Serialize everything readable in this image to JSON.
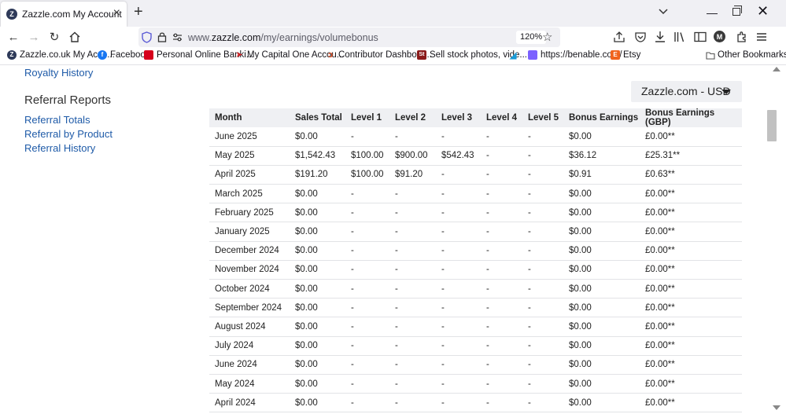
{
  "browser": {
    "tab_title": "Zazzle.com My Account",
    "url_prefix": "www.",
    "url_host": "zazzle.com",
    "url_path": "/my/earnings/volumebonus",
    "zoom": "120%"
  },
  "bookmarks": [
    {
      "label": "Zazzle.co.uk My Acco...",
      "icon": "zazzle-icon",
      "color": "#2e3a59"
    },
    {
      "label": "Facebook",
      "icon": "facebook-icon",
      "color": "#1877f2"
    },
    {
      "label": "Personal Online Banki...",
      "icon": "bank-icon",
      "color": "#d6001c"
    },
    {
      "label": "My Capital One Accou...",
      "icon": "capital-one-icon",
      "color": "#cc2427"
    },
    {
      "label": "Contributor Dashboar...",
      "icon": "contributor-icon",
      "color": "#e4572e"
    },
    {
      "label": "Sell stock photos, vide...",
      "icon": "stock-icon",
      "color": "#8b1a1a"
    },
    {
      "label": "",
      "icon": "feather-icon",
      "color": "#1a9bd7"
    },
    {
      "label": "https://benable.com/",
      "icon": "benable-icon",
      "color": "#7b61ff"
    },
    {
      "label": "Etsy",
      "icon": "etsy-icon",
      "color": "#f1641e"
    },
    {
      "label": "Other Bookmarks",
      "icon": "folder-icon",
      "color": "#555555"
    }
  ],
  "sidebar": {
    "royalty_history": "Royalty History",
    "referral_heading": "Referral Reports",
    "referral_totals": "Referral Totals",
    "referral_by_product": "Referral by Product",
    "referral_history": "Referral History"
  },
  "currency_select": "Zazzle.com - USD",
  "table": {
    "headers": [
      "Month",
      "Sales Total",
      "Level 1",
      "Level 2",
      "Level 3",
      "Level 4",
      "Level 5",
      "Bonus Earnings",
      "Bonus Earnings (GBP)"
    ],
    "rows": [
      [
        "June 2025",
        "$0.00",
        "-",
        "-",
        "-",
        "-",
        "-",
        "$0.00",
        "£0.00**"
      ],
      [
        "May 2025",
        "$1,542.43",
        "$100.00",
        "$900.00",
        "$542.43",
        "-",
        "-",
        "$36.12",
        "£25.31**"
      ],
      [
        "April 2025",
        "$191.20",
        "$100.00",
        "$91.20",
        "-",
        "-",
        "-",
        "$0.91",
        "£0.63**"
      ],
      [
        "March 2025",
        "$0.00",
        "-",
        "-",
        "-",
        "-",
        "-",
        "$0.00",
        "£0.00**"
      ],
      [
        "February 2025",
        "$0.00",
        "-",
        "-",
        "-",
        "-",
        "-",
        "$0.00",
        "£0.00**"
      ],
      [
        "January 2025",
        "$0.00",
        "-",
        "-",
        "-",
        "-",
        "-",
        "$0.00",
        "£0.00**"
      ],
      [
        "December 2024",
        "$0.00",
        "-",
        "-",
        "-",
        "-",
        "-",
        "$0.00",
        "£0.00**"
      ],
      [
        "November 2024",
        "$0.00",
        "-",
        "-",
        "-",
        "-",
        "-",
        "$0.00",
        "£0.00**"
      ],
      [
        "October 2024",
        "$0.00",
        "-",
        "-",
        "-",
        "-",
        "-",
        "$0.00",
        "£0.00**"
      ],
      [
        "September 2024",
        "$0.00",
        "-",
        "-",
        "-",
        "-",
        "-",
        "$0.00",
        "£0.00**"
      ],
      [
        "August 2024",
        "$0.00",
        "-",
        "-",
        "-",
        "-",
        "-",
        "$0.00",
        "£0.00**"
      ],
      [
        "July 2024",
        "$0.00",
        "-",
        "-",
        "-",
        "-",
        "-",
        "$0.00",
        "£0.00**"
      ],
      [
        "June 2024",
        "$0.00",
        "-",
        "-",
        "-",
        "-",
        "-",
        "$0.00",
        "£0.00**"
      ],
      [
        "May 2024",
        "$0.00",
        "-",
        "-",
        "-",
        "-",
        "-",
        "$0.00",
        "£0.00**"
      ],
      [
        "April 2024",
        "$0.00",
        "-",
        "-",
        "-",
        "-",
        "-",
        "$0.00",
        "£0.00**"
      ]
    ]
  },
  "colors": {
    "link": "#1f5ba8",
    "header_bg": "#eff0f3"
  }
}
